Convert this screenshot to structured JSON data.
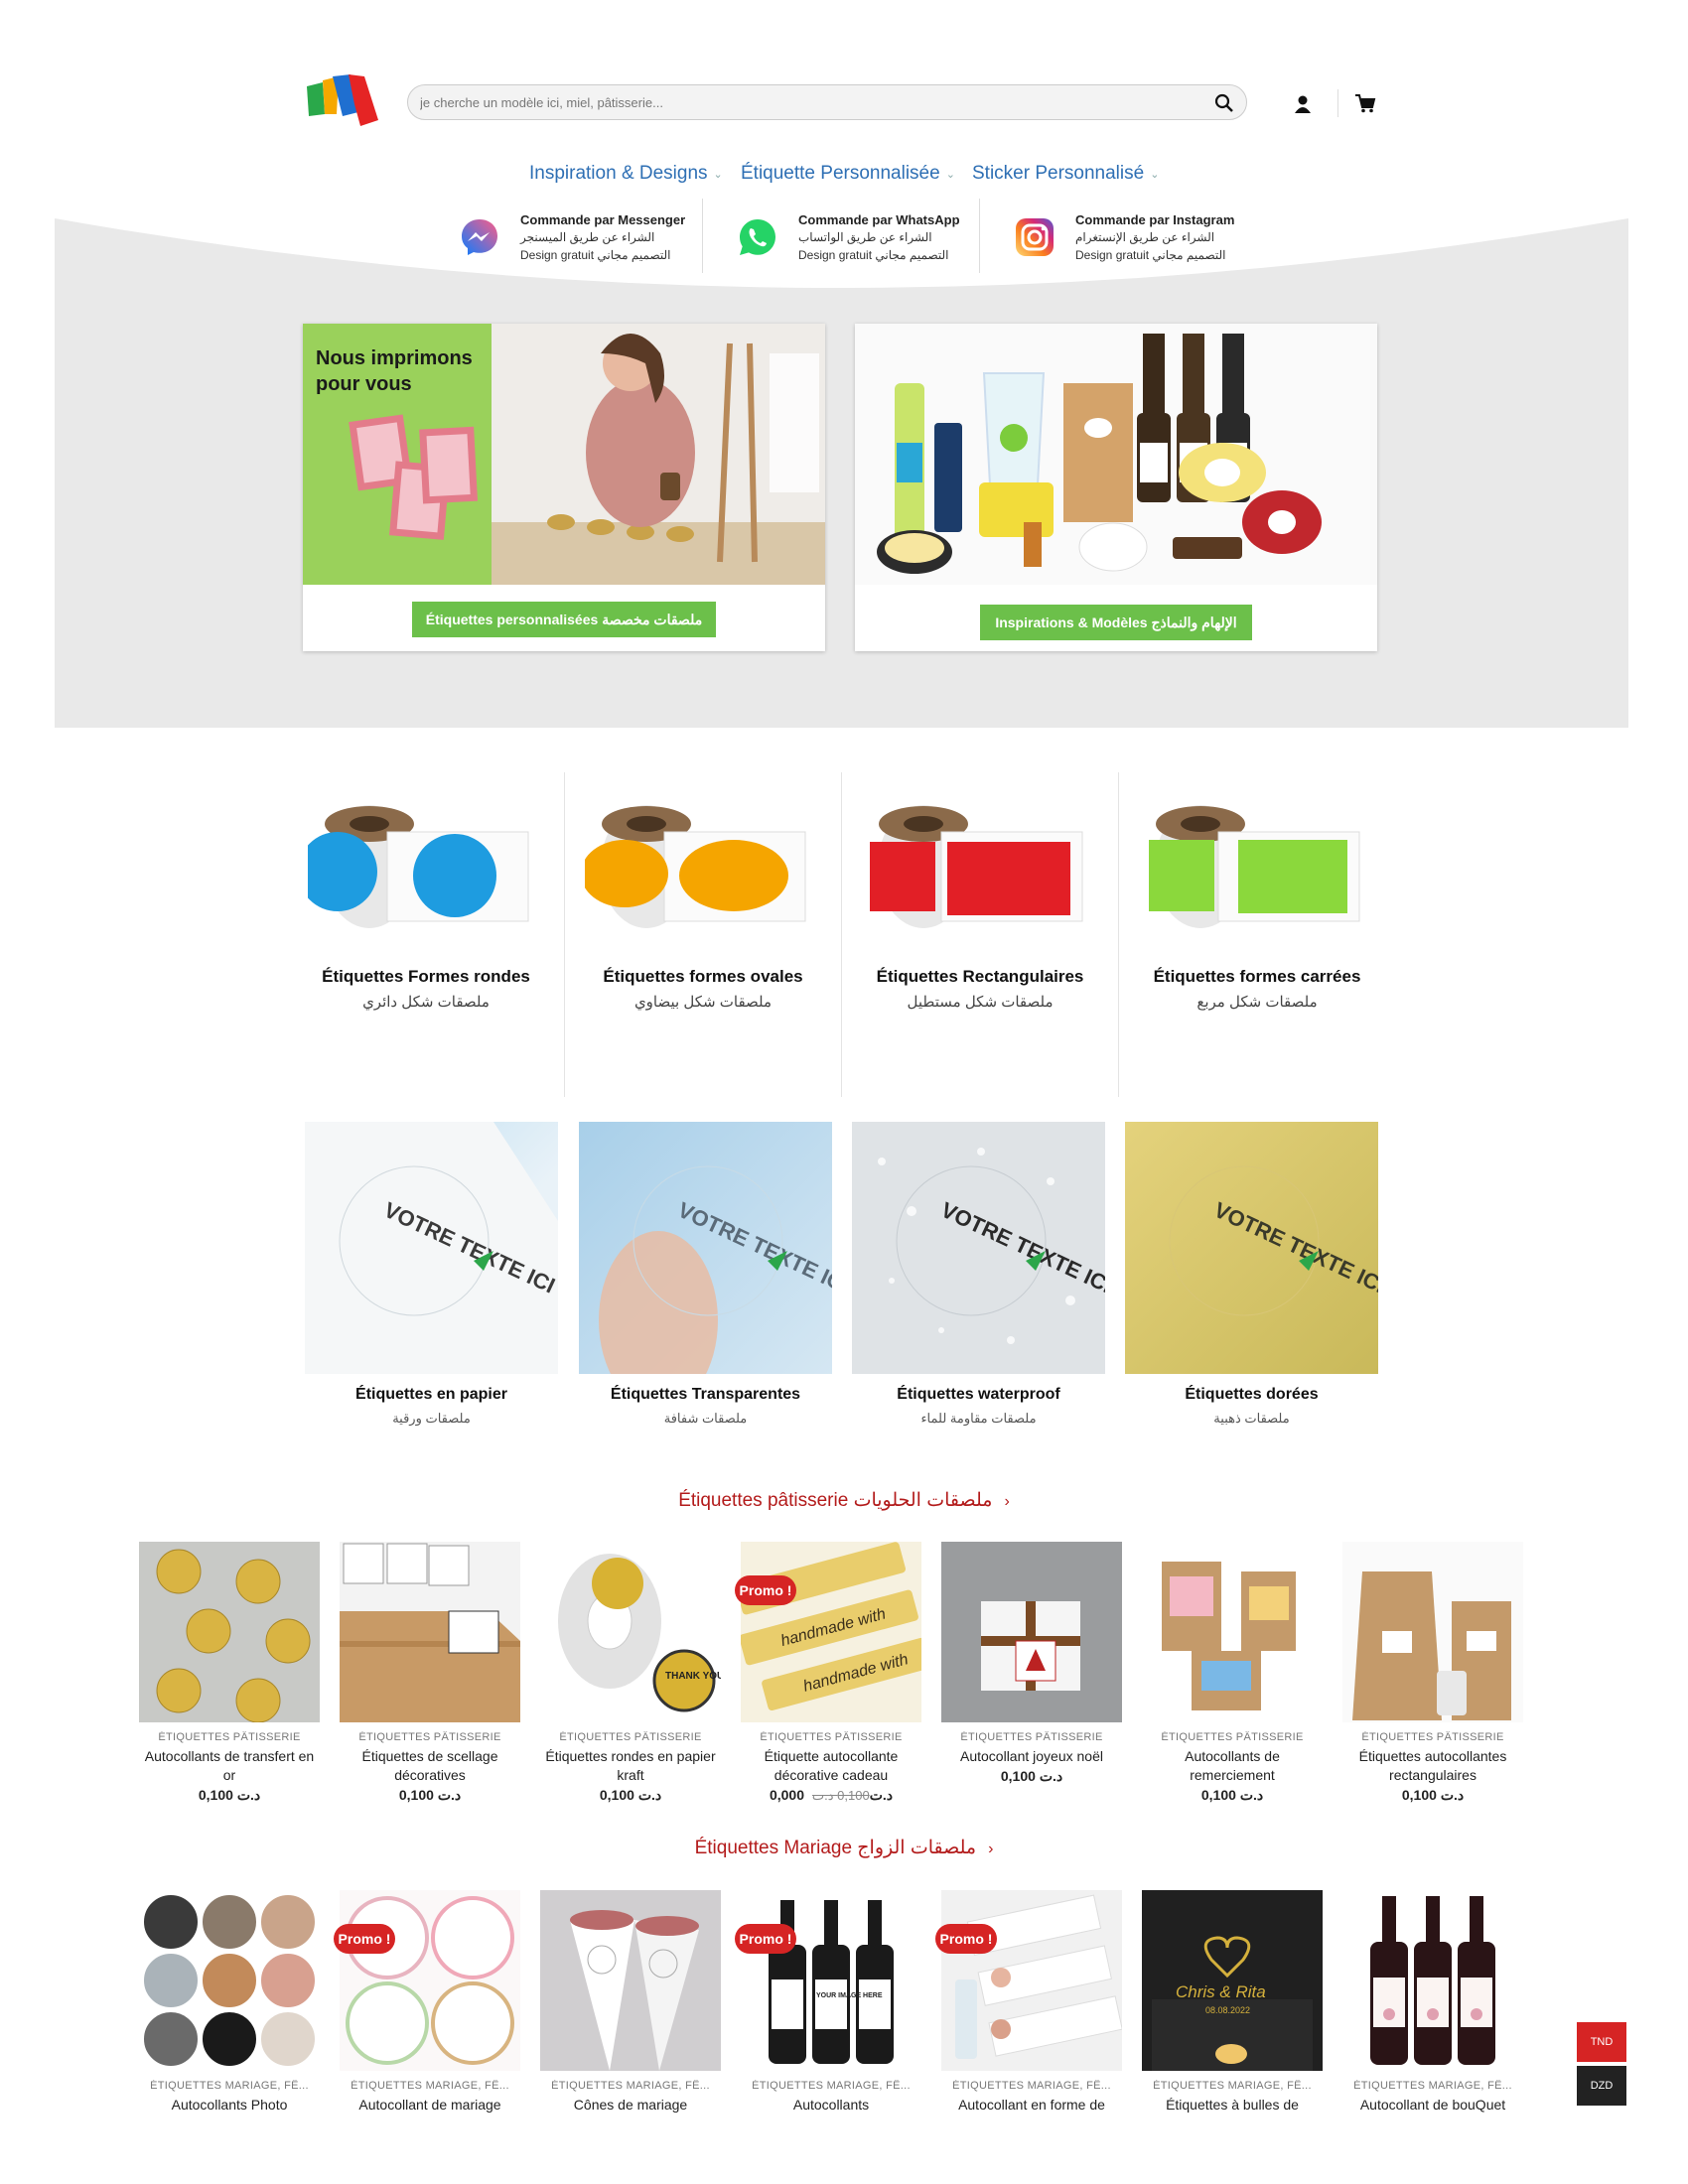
{
  "header": {
    "search_placeholder": "je cherche un modèle ici, miel, pâtisserie...",
    "icons": [
      "search-icon",
      "user-icon",
      "cart-icon"
    ]
  },
  "nav": [
    {
      "label": "Inspiration & Designs"
    },
    {
      "label": "Étiquette Personnalisée"
    },
    {
      "label": "Sticker Personnalisé"
    }
  ],
  "contacts": [
    {
      "title": "Commande par Messenger",
      "arabic": "الشراء عن طريق الميسنجر",
      "design": "Design gratuit",
      "design_ar": "التصميم مجاني",
      "icon": "messenger-icon"
    },
    {
      "title": "Commande par WhatsApp",
      "arabic": "الشراء عن طريق الواتساب",
      "design": "Design gratuit",
      "design_ar": "التصميم مجاني",
      "icon": "whatsapp-icon"
    },
    {
      "title": "Commande par Instagram",
      "arabic": "الشراء عن طريق الإنستغرام",
      "design": "Design gratuit",
      "design_ar": "التصميم مجاني",
      "icon": "instagram-icon"
    }
  ],
  "hero": {
    "left_overlay": "Nous imprimons pour vous",
    "left_button": "Étiquettes personnalisées ملصقات مخصصة",
    "right_button": "Inspirations & Modèles الإلهام والنماذج",
    "hero_accent": "#6cc04a"
  },
  "shapes": [
    {
      "title": "Étiquettes Formes rondes",
      "sub": "ملصقات شكل دائري",
      "color": "#1e9ce0"
    },
    {
      "title": "Étiquettes formes ovales",
      "sub": "ملصقات شكل بيضاوي",
      "color": "#f5a500"
    },
    {
      "title": "Étiquettes Rectangulaires",
      "sub": "ملصقات شكل مستطيل",
      "color": "#e21f26"
    },
    {
      "title": "Étiquettes formes carrées",
      "sub": "ملصقات شكل مربع",
      "color": "#8bd83c"
    }
  ],
  "materials": [
    {
      "title": "Étiquettes en papier",
      "sub": "ملصقات ورقية",
      "img_text": "VOTRE TEXTE ICI"
    },
    {
      "title": "Étiquettes Transparentes",
      "sub": "ملصقات شفافة",
      "img_text": "VOTRE TEXTE ICI"
    },
    {
      "title": "Étiquettes waterproof",
      "sub": "ملصقات مقاومة للماء",
      "img_text": "VOTRE TEXTE ICI"
    },
    {
      "title": "Étiquettes dorées",
      "sub": "ملصقات ذهبية",
      "img_text": "VOTRE TEXTE ICI"
    }
  ],
  "sections": {
    "patisserie_title": "Étiquettes pâtisserie ملصقات الحلويات",
    "mariage_title": "Étiquettes Mariage ملصقات الزواج",
    "arrow": "›"
  },
  "patisserie_products": [
    {
      "cat": "ÉTIQUETTES PÂTISSERIE",
      "name": "Autocollants de transfert en or",
      "price": "0,100 د.ت",
      "old": "",
      "promo": false
    },
    {
      "cat": "ÉTIQUETTES PÂTISSERIE",
      "name": "Étiquettes de scellage décoratives",
      "price": "0,100 د.ت",
      "old": "",
      "promo": false
    },
    {
      "cat": "ÉTIQUETTES PÂTISSERIE",
      "name": "Étiquettes rondes en papier kraft",
      "price": "0,100 د.ت",
      "old": "",
      "promo": false
    },
    {
      "cat": "ÉTIQUETTES PÂTISSERIE",
      "name": "Étiquette autocollante décorative cadeau",
      "price": "0,000 د.ت",
      "old": "0,100 د.ت",
      "promo": true
    },
    {
      "cat": "ÉTIQUETTES PÂTISSERIE",
      "name": "Autocollant joyeux noël",
      "price": "0,100 د.ت",
      "old": "",
      "promo": false
    },
    {
      "cat": "ÉTIQUETTES PÂTISSERIE",
      "name": "Autocollants de remerciement",
      "price": "0,100 د.ت",
      "old": "",
      "promo": false
    },
    {
      "cat": "ÉTIQUETTES PÂTISSERIE",
      "name": "Étiquettes autocollantes rectangulaires",
      "price": "0,100 د.ت",
      "old": "",
      "promo": false
    }
  ],
  "mariage_products": [
    {
      "cat": "ÉTIQUETTES MARIAGE, FÊ...",
      "name": "Autocollants Photo",
      "promo": false
    },
    {
      "cat": "ÉTIQUETTES MARIAGE, FÊ...",
      "name": "Autocollant de mariage",
      "promo": true
    },
    {
      "cat": "ÉTIQUETTES MARIAGE, FÊ...",
      "name": "Cônes de mariage",
      "promo": false
    },
    {
      "cat": "ÉTIQUETTES MARIAGE, FÊ...",
      "name": "Autocollants",
      "promo": true
    },
    {
      "cat": "ÉTIQUETTES MARIAGE, FÊ...",
      "name": "Autocollant en forme de",
      "promo": true
    },
    {
      "cat": "ÉTIQUETTES MARIAGE, FÊ...",
      "name": "Étiquettes à bulles de",
      "promo": false
    },
    {
      "cat": "ÉTIQUETTES MARIAGE, FÊ...",
      "name": "Autocollant de bouQuet",
      "promo": false
    }
  ],
  "product_images": {
    "chris_rita": "Chris & Rita",
    "chris_rita_date": "08.08.2022",
    "your_image": "YOUR IMAGE HERE",
    "thank_you": "THANK YOU",
    "handmade": "handmade with"
  },
  "promo_label": "Promo !",
  "currency": [
    "TND",
    "DZD"
  ],
  "colors": {
    "brand_blue": "#2e6fb4",
    "promo_red": "#d62424",
    "section_red": "#b31b1b",
    "button_green": "#6cc04a",
    "currency_red": "#d62424",
    "currency_dark": "#222222"
  }
}
